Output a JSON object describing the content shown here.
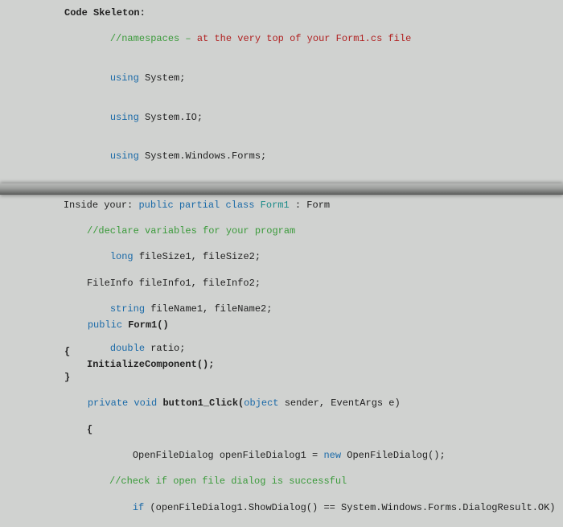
{
  "top": {
    "heading": "Code Skeleton:",
    "ns_comment_pre": "//namespaces – ",
    "ns_comment_red": "at the very top of your Form1.cs file",
    "l1a": "using ",
    "l1b": "System;",
    "l2a": "using ",
    "l2b": "System.IO;",
    "l3a": "using ",
    "l3b": "System.Windows.Forms;",
    "inside_pre": "Inside your: ",
    "inside_kw": "public partial class ",
    "inside_cls": "Form1",
    "inside_rest": " : Form",
    "decl_comment": "//declare variables for your program",
    "v1a": "long ",
    "v1b": "fileSize1, fileSize2;",
    "v2": "FileInfo fileInfo1, fileInfo2;",
    "v3a": "string ",
    "v3b": "fileName1, fileName2;",
    "v4a": "double ",
    "v4b": "ratio;"
  },
  "bottom": {
    "ctor1a": "public ",
    "ctor1b": "Form1()",
    "brace_open": "{",
    "init": "InitializeComponent();",
    "brace_close": "}",
    "m1a": "private void ",
    "m1b": "button1_Click(",
    "m1c": "object ",
    "m1d": "sender, EventArgs e)",
    "b1a": "OpenFileDialog openFileDialog1 = ",
    "b1b": "new ",
    "b1c": "OpenFileDialog();",
    "b2": "//check if open file dialog is successful",
    "b3a": "if ",
    "b3b": "(openFileDialog1.ShowDialog() == System.Windows.Forms.DialogResult.OK)"
  }
}
